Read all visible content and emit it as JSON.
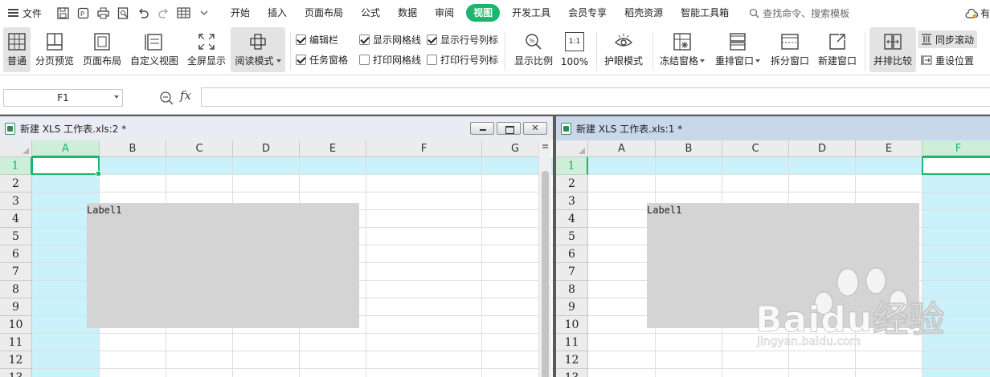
{
  "menubar": {
    "file_label": "文件",
    "tabs": [
      "开始",
      "插入",
      "页面布局",
      "公式",
      "数据",
      "审阅",
      "视图",
      "开发工具",
      "会员专享",
      "稻壳资源",
      "智能工具箱"
    ],
    "active_tab": "视图",
    "search_placeholder": "查找命令、搜索模板",
    "user_label": "有"
  },
  "ribbon": {
    "normal": "普通",
    "page_break_preview": "分页预览",
    "page_layout": "页面布局",
    "custom_view": "自定义视图",
    "full_screen": "全屏显示",
    "reading_mode": "阅读模式",
    "checkboxes": {
      "formula_bar": {
        "label": "编辑栏",
        "checked": true
      },
      "show_gridlines": {
        "label": "显示网格线",
        "checked": true
      },
      "show_headings": {
        "label": "显示行号列标",
        "checked": true
      },
      "task_pane": {
        "label": "任务窗格",
        "checked": true
      },
      "print_gridlines": {
        "label": "打印网格线",
        "checked": false
      },
      "print_headings": {
        "label": "打印行号列标",
        "checked": false
      }
    },
    "zoom": "显示比例",
    "zoom_100": "100%",
    "zoom_100_icon": "1:1",
    "eye_protection": "护眼模式",
    "freeze_panes": "冻结窗格",
    "arrange_windows": "重排窗口",
    "split_window": "拆分窗口",
    "new_window": "新建窗口",
    "side_by_side": "并排比较",
    "sync_scroll": "同步滚动",
    "reset_position": "重设位置"
  },
  "formula": {
    "name_box": "F1",
    "fx_label": "fx",
    "value": ""
  },
  "left_window": {
    "title": "新建 XLS 工作表.xls:2 *",
    "columns": [
      "A",
      "B",
      "C",
      "D",
      "E",
      "F",
      "G"
    ],
    "selected_col": "A",
    "rows": [
      "1",
      "2",
      "3",
      "4",
      "5",
      "6",
      "7",
      "8",
      "9",
      "10",
      "11",
      "12",
      "13"
    ],
    "selected_row": "1",
    "label_control": "Label1"
  },
  "right_window": {
    "title": "新建 XLS 工作表.xls:1 *",
    "columns": [
      "A",
      "B",
      "C",
      "D",
      "E",
      "F"
    ],
    "selected_col": "F",
    "rows": [
      "1",
      "2",
      "3",
      "4",
      "5",
      "6",
      "7",
      "8",
      "9",
      "10",
      "11",
      "12",
      "13"
    ],
    "selected_row": "1",
    "label_control": "Label1"
  },
  "watermark": {
    "brand": "Baidu经验",
    "url": "jingyan.baidu.com"
  },
  "colors": {
    "accent": "#1bb56d",
    "row_col_highlight": "#cbf1fa",
    "label_fill": "#d4d4d4"
  }
}
